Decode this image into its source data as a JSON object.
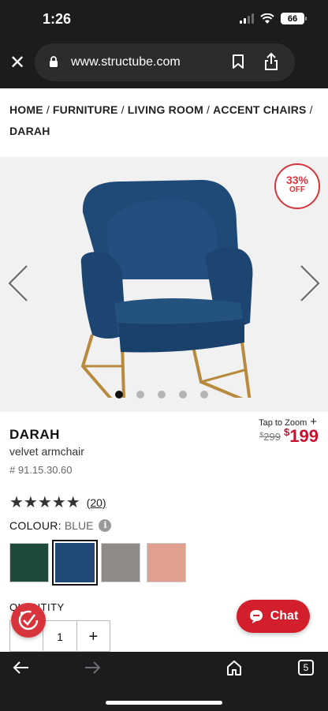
{
  "status": {
    "time": "1:26",
    "battery": "66"
  },
  "browser": {
    "url": "www.structube.com"
  },
  "breadcrumb": [
    "HOME",
    "FURNITURE",
    "LIVING ROOM",
    "ACCENT CHAIRS",
    "DARAH"
  ],
  "breadcrumb_sep": "/",
  "badge": {
    "percent": "33%",
    "off": "OFF"
  },
  "gallery": {
    "slides": 5,
    "active_slide": 1
  },
  "product": {
    "name": "DARAH",
    "subtitle": "velvet armchair",
    "sku": "# 91.15.30.60",
    "zoom_hint": "Tap to Zoom",
    "zoom_plus": "+",
    "old_price_currency": "$",
    "old_price": "299",
    "new_price_currency": "$",
    "new_price": "199",
    "stars": "★★★★★",
    "rating": 5,
    "reviews": "(20)"
  },
  "colour": {
    "label": "COLOUR:",
    "value": "BLUE",
    "info": "i",
    "swatches": [
      {
        "name": "green",
        "color": "#1e4a3a"
      },
      {
        "name": "blue",
        "color": "#1f4a78"
      },
      {
        "name": "grey",
        "color": "#8f8a86"
      },
      {
        "name": "pink",
        "color": "#e0a090"
      }
    ],
    "selected": "blue"
  },
  "quantity": {
    "label": "QUANTITY",
    "minus": "",
    "value": "1",
    "plus": "+"
  },
  "chat": {
    "label": "Chat"
  },
  "toolbar": {
    "tabs_count": "5"
  }
}
